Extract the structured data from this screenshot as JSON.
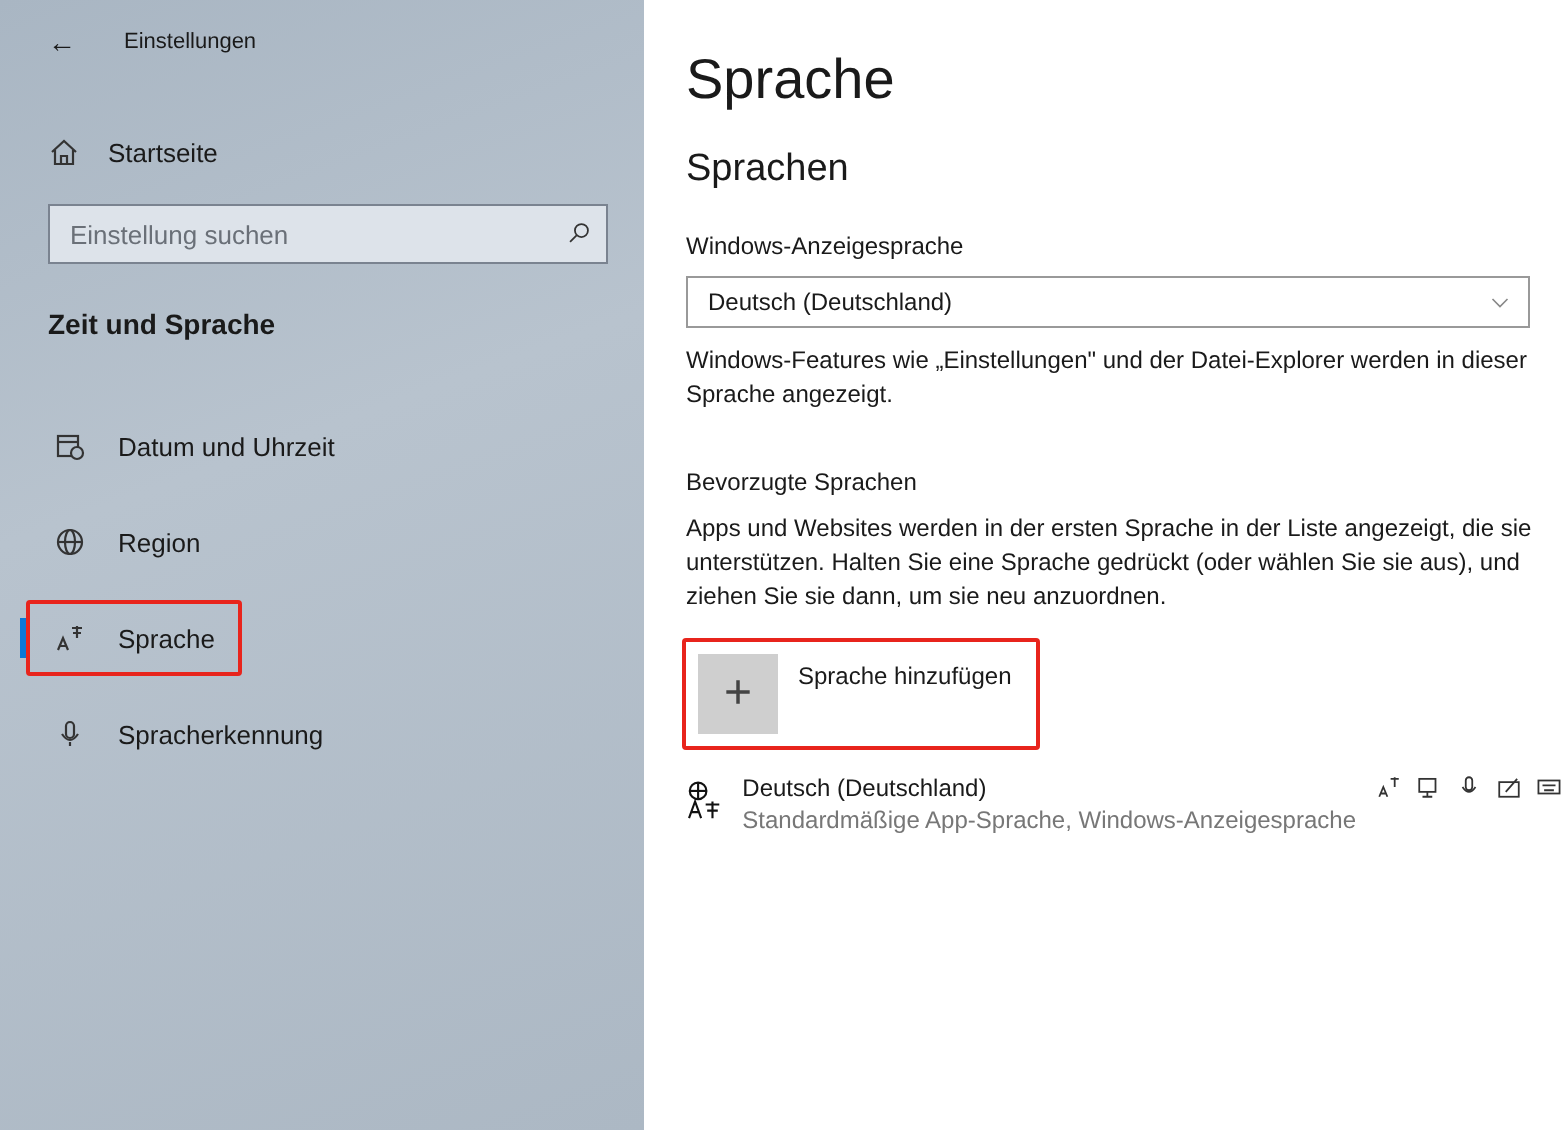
{
  "sidebar": {
    "back": "←",
    "title": "Einstellungen",
    "home": "Startseite",
    "search": {
      "placeholder": "Einstellung suchen"
    },
    "section": "Zeit und Sprache",
    "items": [
      {
        "kind": "calendar",
        "label": "Datum und Uhrzeit",
        "selected": false,
        "highlighted": false
      },
      {
        "kind": "globe",
        "label": "Region",
        "selected": false,
        "highlighted": false
      },
      {
        "kind": "language",
        "label": "Sprache",
        "selected": true,
        "highlighted": true
      },
      {
        "kind": "mic",
        "label": "Spracherkennung",
        "selected": false,
        "highlighted": false
      }
    ]
  },
  "main": {
    "title": "Sprache",
    "subtitle": "Sprachen",
    "display_label": "Windows-Anzeigesprache",
    "display_value": "Deutsch (Deutschland)",
    "display_note": "Windows-Features wie „Einstellungen\" und der Datei-Explorer werden in dieser Sprache angezeigt.",
    "preferred_label": "Bevorzugte Sprachen",
    "preferred_note": "Apps und Websites werden in der ersten Sprache in der Liste angezeigt, die sie unterstützen. Halten Sie eine Sprache gedrückt (oder wählen Sie sie aus), und ziehen Sie sie dann, um sie neu anzuordnen.",
    "add_button": {
      "plus": "+",
      "label": "Sprache hinzufügen",
      "highlighted": true
    },
    "languages": [
      {
        "name": "Deutsch (Deutschland)",
        "detail": "Standardmäßige App-Sprache, Windows-Anzeigesprache"
      }
    ]
  }
}
